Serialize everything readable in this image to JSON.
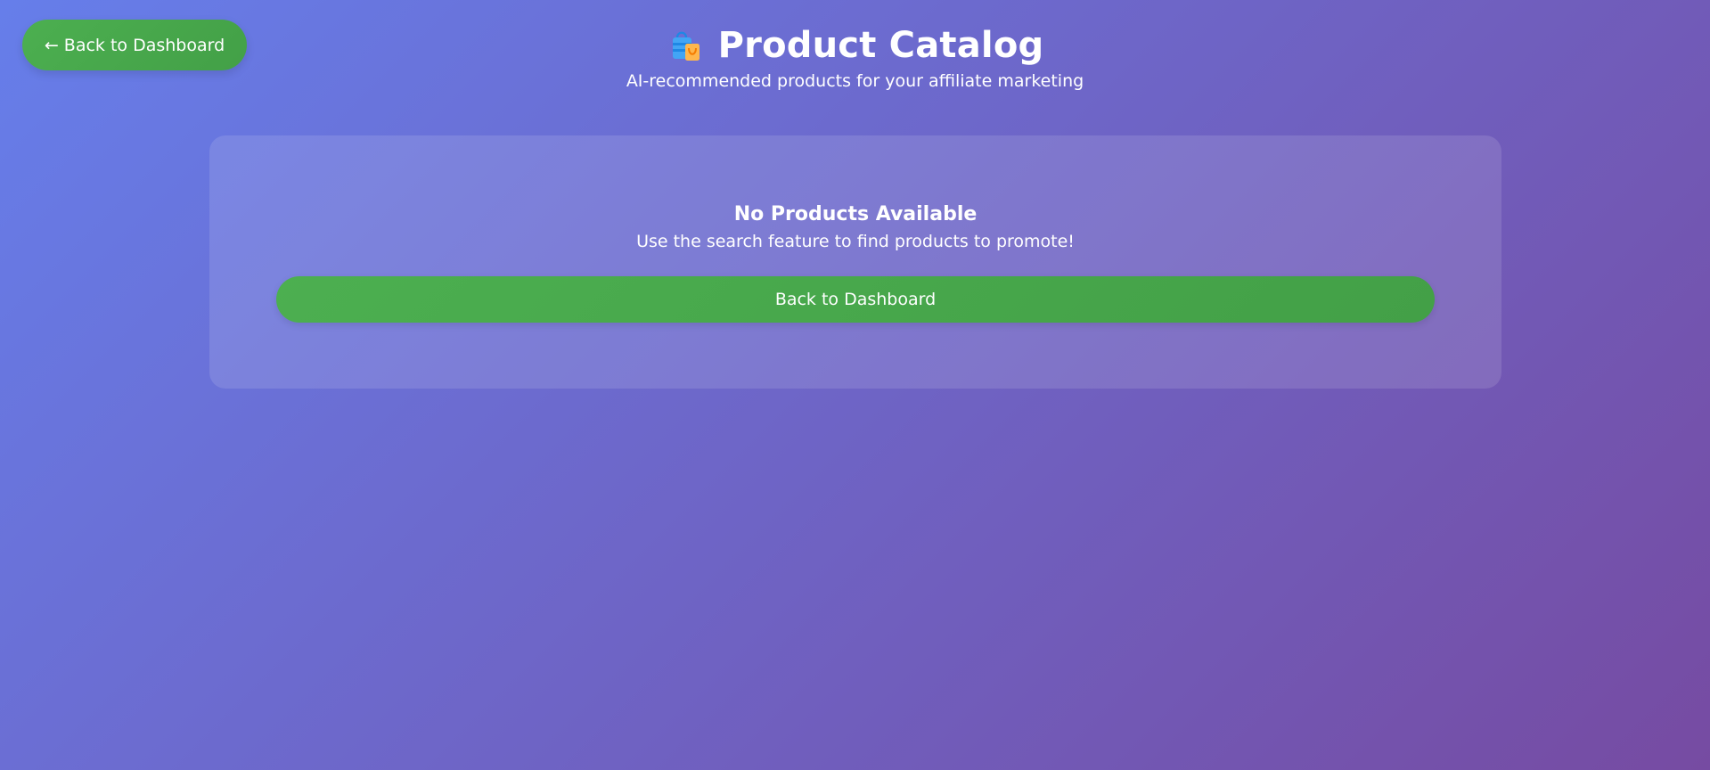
{
  "nav": {
    "back_label": "← Back to Dashboard"
  },
  "header": {
    "icon": "shopping-bags-icon",
    "title": "Product Catalog",
    "subtitle": "AI-recommended products for your affiliate marketing"
  },
  "empty_state": {
    "title": "No Products Available",
    "message": "Use the search feature to find products to promote!",
    "button_label": "Back to Dashboard"
  },
  "colors": {
    "background_start": "#667eea",
    "background_end": "#764ba2",
    "button_green": "#4caf50",
    "text": "#ffffff"
  }
}
